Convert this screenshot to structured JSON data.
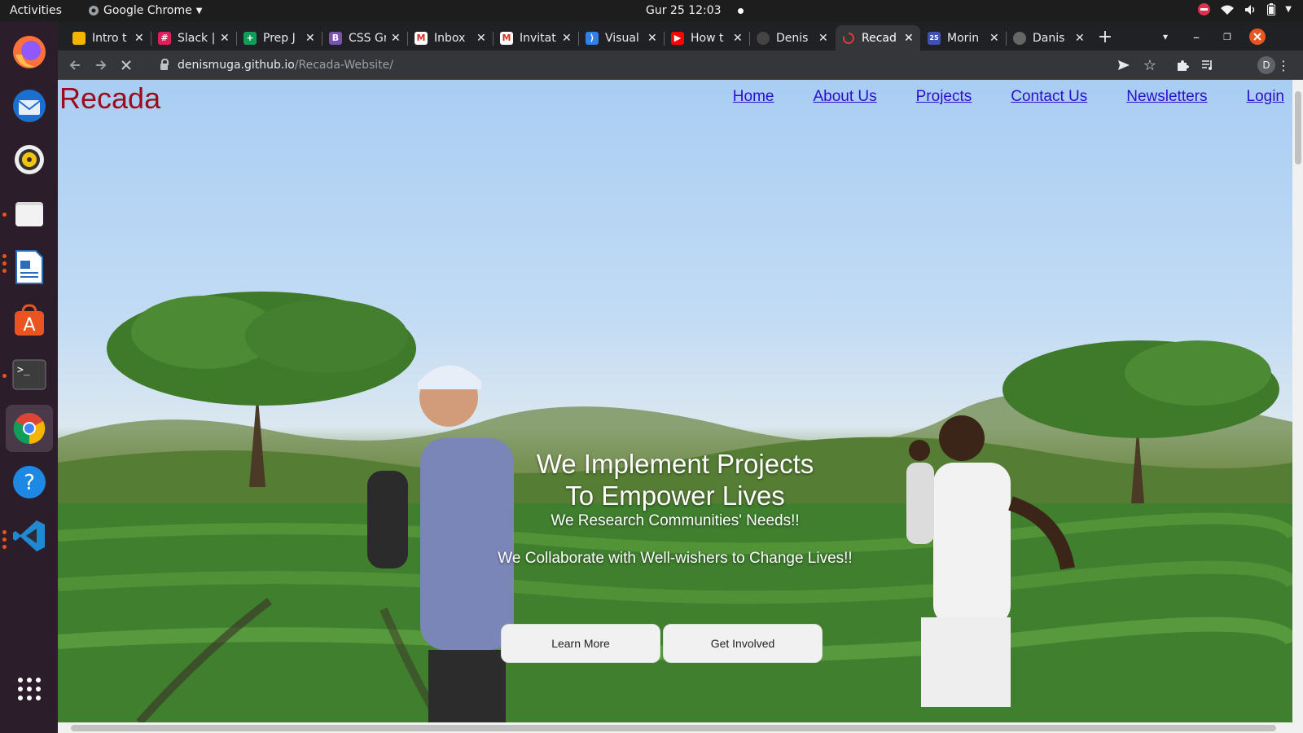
{
  "topbar": {
    "activities": "Activities",
    "app_name": "Google Chrome",
    "clock": "Gur 25  12:03"
  },
  "dock": {
    "apps": [
      "firefox-icon",
      "thunderbird-icon",
      "rhythmbox-icon",
      "files-icon",
      "writer-icon",
      "software-icon",
      "terminal-icon",
      "chrome-icon",
      "help-icon",
      "vscode-icon",
      "show-apps-icon"
    ]
  },
  "tabs": [
    {
      "title": "Intro t",
      "favicon_color": "#f4b400"
    },
    {
      "title": "Slack |",
      "favicon_color": "#e01e5a"
    },
    {
      "title": "Prep J",
      "favicon_color": "#0f9d58"
    },
    {
      "title": "CSS Gr",
      "favicon_color": "#7952b3",
      "favicon_letter": "B"
    },
    {
      "title": "Inbox",
      "favicon_color": "#d93025",
      "favicon_letter": "M"
    },
    {
      "title": "Invitat",
      "favicon_color": "#d93025",
      "favicon_letter": "M"
    },
    {
      "title": "Visual",
      "favicon_color": "#2f80ed"
    },
    {
      "title": "How t",
      "favicon_color": "#ff0000"
    },
    {
      "title": "Denis",
      "favicon_color": "#444444"
    },
    {
      "title": "Recad",
      "favicon_color": "#e53935",
      "active": true
    },
    {
      "title": "Morin",
      "favicon_color": "#3f51b5",
      "favicon_letter": "25"
    },
    {
      "title": "Danis",
      "favicon_color": "#666666"
    }
  ],
  "toolbar": {
    "url_host": "denismuga.github.io",
    "url_path": "/Recada-Website/",
    "profile_initial": "D"
  },
  "page": {
    "logo": "Recada",
    "nav": [
      "Home",
      "About Us",
      "Projects",
      "Contact Us",
      "Newsletters",
      "Login"
    ],
    "hero": {
      "heading_line1": "We Implement Projects",
      "heading_line2": "To Empower Lives",
      "subheading1": "We Research Communities' Needs!!",
      "subheading2": "We Collaborate with Well-wishers to Change Lives!!"
    },
    "buttons": {
      "learn_more": "Learn More",
      "get_involved": "Get Involved"
    }
  },
  "colors": {
    "logo": "#9b0b1c",
    "nav_link": "#2a0fcc",
    "ubuntu_accent": "#e95420"
  }
}
